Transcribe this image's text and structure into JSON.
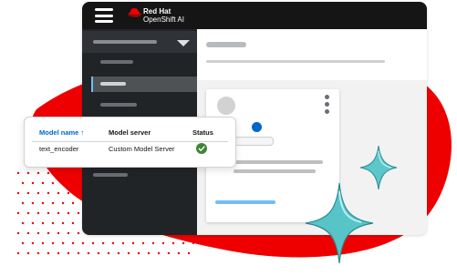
{
  "colors": {
    "brand_red": "#ee0000",
    "masthead": "#151515",
    "sidebar": "#212427",
    "accent_blue": "#0066cc",
    "success_green": "#3e8635",
    "sparkle_teal": "#58c4c8"
  },
  "masthead": {
    "brand_line_1": "Red Hat",
    "brand_line_2": "OpenShift AI",
    "menu_icon": "hamburger-icon",
    "logo_icon": "red-hat-icon"
  },
  "table": {
    "columns": [
      {
        "label": "Model name ↑",
        "sortable": true
      },
      {
        "label": "Model server",
        "sortable": false
      },
      {
        "label": "Status",
        "sortable": false
      }
    ],
    "rows": [
      {
        "model_name": "text_encoder",
        "model_server": "Custom Model Server",
        "status_icon": "check-circle-icon",
        "status_color": "#3e8635"
      }
    ]
  },
  "decor": {
    "sparkle_icon": "sparkle-icon",
    "kebab_icon": "kebab-icon"
  }
}
